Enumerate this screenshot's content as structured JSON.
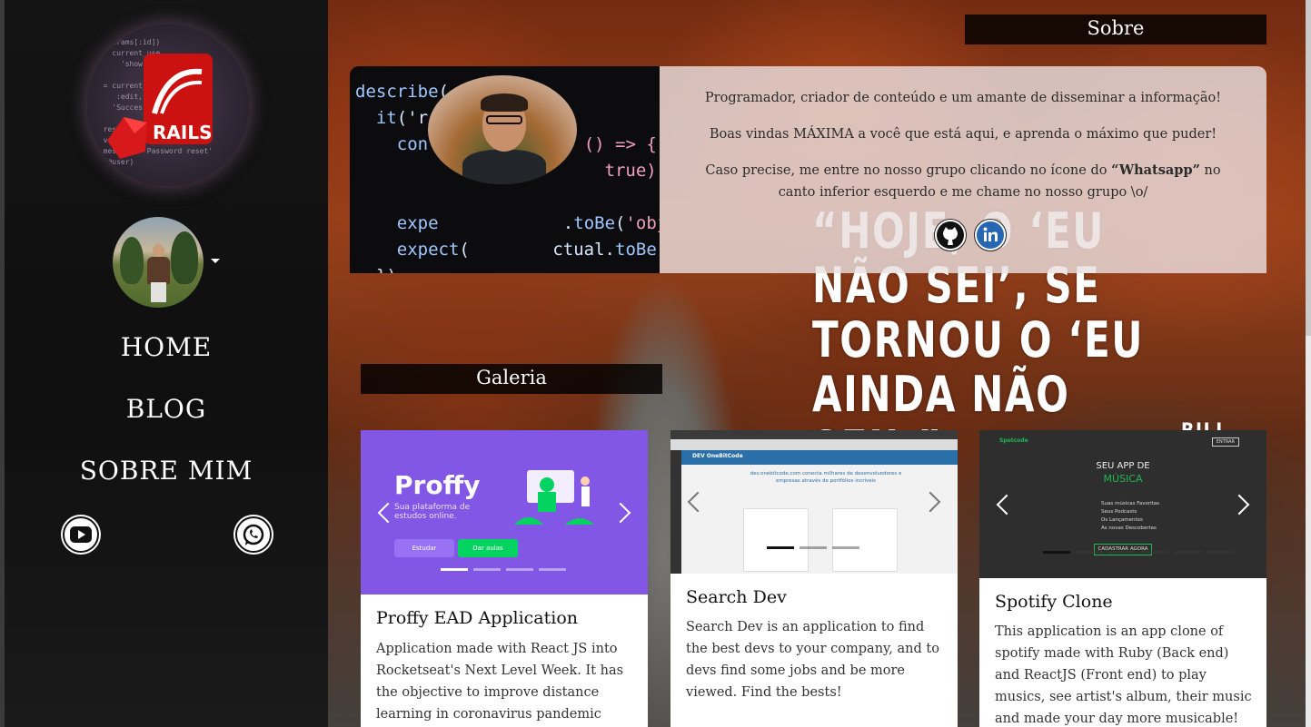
{
  "sidebar": {
    "nav": [
      {
        "label": "HOME"
      },
      {
        "label": "BLOG"
      },
      {
        "label": "SOBRE MIM"
      }
    ],
    "logo_code": "it(params[:id])\n    current_use\n      'show'\n\n  = current_user\n     :edit, :update\n    'Success'\n\n  reset.empty?\n  valid_password\n  message: 'Password reset'\n  (@user)"
  },
  "about": {
    "heading": "Sobre",
    "paragraphs": [
      "Programador, criador de conteúdo e um amante de disseminar a informação!",
      "Boas vindas MÁXIMA a você que está aqui, e aprenda o máximo que puder!"
    ],
    "p3_before": "Caso precise, me entre no nosso grupo clicando no ícone do ",
    "p3_bold": "“Whatsapp”",
    "p3_after": " no canto inferior esquerdo e me chame no nosso grupo \\o/"
  },
  "quote": {
    "text": "“HOJE, O ‘EU NÃO SEI’, SE TORNOU O ‘EU AINDA NÃO SEI’.”",
    "author": "BILL GATES"
  },
  "gallery": {
    "heading": "Galeria",
    "cards": [
      {
        "title": "Proffy EAD Application",
        "description": "Application made with React JS into Rocketseat's Next Level Week. It has the objective to improve distance learning in coronavirus pandemic",
        "shot": {
          "brand": "Proffy",
          "tagline": "Sua plataforma de estudos online.",
          "btn_study": "Estudar",
          "btn_teach": "Dar aulas"
        }
      },
      {
        "title": "Search Dev",
        "description": "Search Dev is an application to find the best devs to your company, and to devs find some jobs and be more viewed. Find the bests!",
        "shot": {
          "brand": "DEV OneBitCode",
          "headline": "dev.onebitcode.com conecta milhares de desenvolvedores e empresas através de portfólios incríveis"
        }
      },
      {
        "title": "Spotify Clone",
        "description": "This application is an app clone of spotify made with Ruby (Back end) and ReactJS (Front end) to play musics, see artist's album, their music and made your day more musicable! Did on",
        "shot": {
          "brand": "Spotcode",
          "headline1": "SEU APP DE",
          "headline2": "MÚSICA",
          "items": [
            "Suas músicas Favoritas",
            "Seus Podcasts",
            "Os Lançamentos",
            "As novas Descobertas"
          ],
          "cta": "CADASTRAR AGORA",
          "login": "ENTRAR"
        }
      }
    ]
  },
  "colors": {
    "proffy_purple": "#8257e5",
    "proffy_green": "#04d361",
    "spotcode_green": "#1db954"
  }
}
